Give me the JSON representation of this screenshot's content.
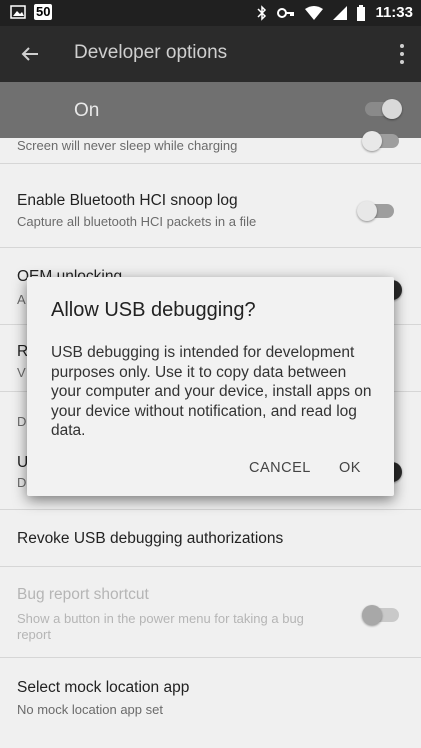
{
  "status_bar": {
    "notif_badge": "50",
    "time": "11:33",
    "icons": [
      "image-icon",
      "bluetooth-icon",
      "key-icon",
      "wifi-icon",
      "signal-icon",
      "battery-icon"
    ]
  },
  "toolbar": {
    "title": "Developer options",
    "back_icon": "arrow-back-icon",
    "menu_icon": "overflow-menu-icon"
  },
  "switch_bar": {
    "label": "On",
    "state": "on"
  },
  "list": {
    "stay_awake_sub": "Screen will never sleep while charging",
    "bt_hci": {
      "title": "Enable Bluetooth HCI snoop log",
      "sub": "Capture all bluetooth HCI packets in a file",
      "state": "off"
    },
    "oem_unlocking": {
      "title_partial": "OEM unlocking",
      "sub_partial": "A"
    },
    "r_item": {
      "title_partial": "R",
      "sub_partial": "V"
    },
    "d_header": "D",
    "u_item": {
      "title_partial": "U",
      "sub_partial": "D"
    },
    "revoke": {
      "title": "Revoke USB debugging authorizations"
    },
    "bug_report": {
      "title": "Bug report shortcut",
      "sub": "Show a button in the power menu for taking a bug report",
      "state": "off",
      "enabled": false
    },
    "mock_location": {
      "title": "Select mock location app",
      "sub": "No mock location app set"
    }
  },
  "dialog": {
    "title": "Allow USB debugging?",
    "body": "USB debugging is intended for development purposes only. Use it to copy data between your computer and your device, install apps on your device without notification, and read log data.",
    "cancel_label": "CANCEL",
    "ok_label": "OK"
  },
  "colors": {
    "toolbar_bg": "#2b2b2b",
    "status_bg": "#202020",
    "list_bg": "#f0f0f0",
    "dialog_bg": "#f2f2f2"
  }
}
